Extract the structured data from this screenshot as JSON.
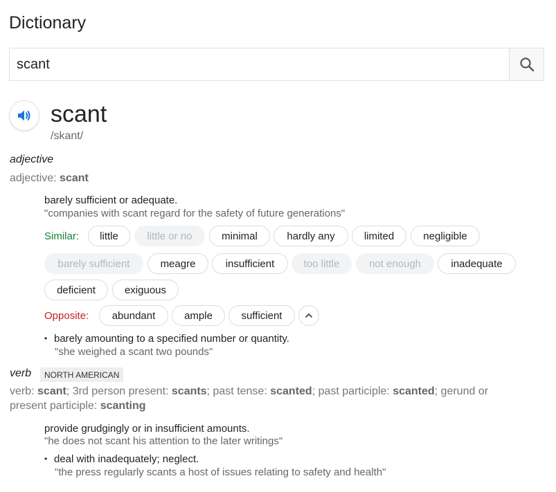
{
  "heading": "Dictionary",
  "search": {
    "value": "scant",
    "icon": "search-icon"
  },
  "entry": {
    "word": "scant",
    "phonetic": "/skant/",
    "adjective": {
      "pos": "adjective",
      "forms_label": "adjective: ",
      "forms_word": "scant",
      "sense1": {
        "definition": "barely sufficient or adequate.",
        "example": "\"companies with scant regard for the safety of future generations\"",
        "similar_label": "Similar:",
        "similar": [
          "little",
          "little or no",
          "minimal",
          "hardly any",
          "limited",
          "negligible",
          "barely sufficient",
          "meagre",
          "insufficient",
          "too little",
          "not enough",
          "inadequate",
          "deficient",
          "exiguous"
        ],
        "opposite_label": "Opposite:",
        "opposite": [
          "abundant",
          "ample",
          "sufficient"
        ]
      },
      "sense2": {
        "bullet": "•",
        "definition": "barely amounting to a specified number or quantity.",
        "example": "\"she weighed a scant two pounds\""
      }
    },
    "verb": {
      "pos": "verb",
      "region": "NORTH AMERICAN",
      "forms": {
        "l1": "verb: ",
        "w1": "scant",
        "l2": "; 3rd person present: ",
        "w2": "scants",
        "l3": "; past tense: ",
        "w3": "scanted",
        "l4": "; past participle: ",
        "w4": "scanted",
        "l5": "; gerund or",
        "l6": "present participle: ",
        "w6": "scanting"
      },
      "sense1": {
        "definition": "provide grudgingly or in insufficient amounts.",
        "example": "\"he does not scant his attention to the later writings\""
      },
      "sense2": {
        "bullet": "•",
        "definition": "deal with inadequately; neglect.",
        "example": "\"the press regularly scants a host of issues relating to safety and health\""
      }
    }
  },
  "colors": {
    "similar": "#188038",
    "opposite": "#c5221f",
    "speaker": "#1a73e8"
  }
}
